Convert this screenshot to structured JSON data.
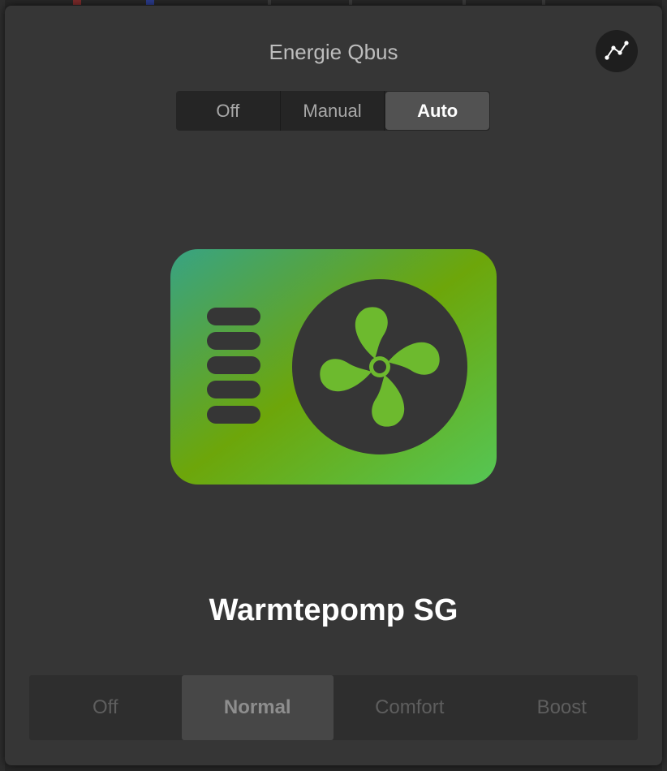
{
  "dialog": {
    "title": "Energie Qbus",
    "history_icon": "chart-line-icon"
  },
  "mode_selector": {
    "options": [
      "Off",
      "Manual",
      "Auto"
    ],
    "selected": "Auto"
  },
  "device": {
    "name": "Warmtepomp SG",
    "icon": "heat-pump-icon",
    "gradient_colors": [
      "#38a383",
      "#6da60a",
      "#55c655"
    ]
  },
  "preset_selector": {
    "options": [
      "Off",
      "Normal",
      "Comfort",
      "Boost"
    ],
    "selected": "Normal"
  }
}
